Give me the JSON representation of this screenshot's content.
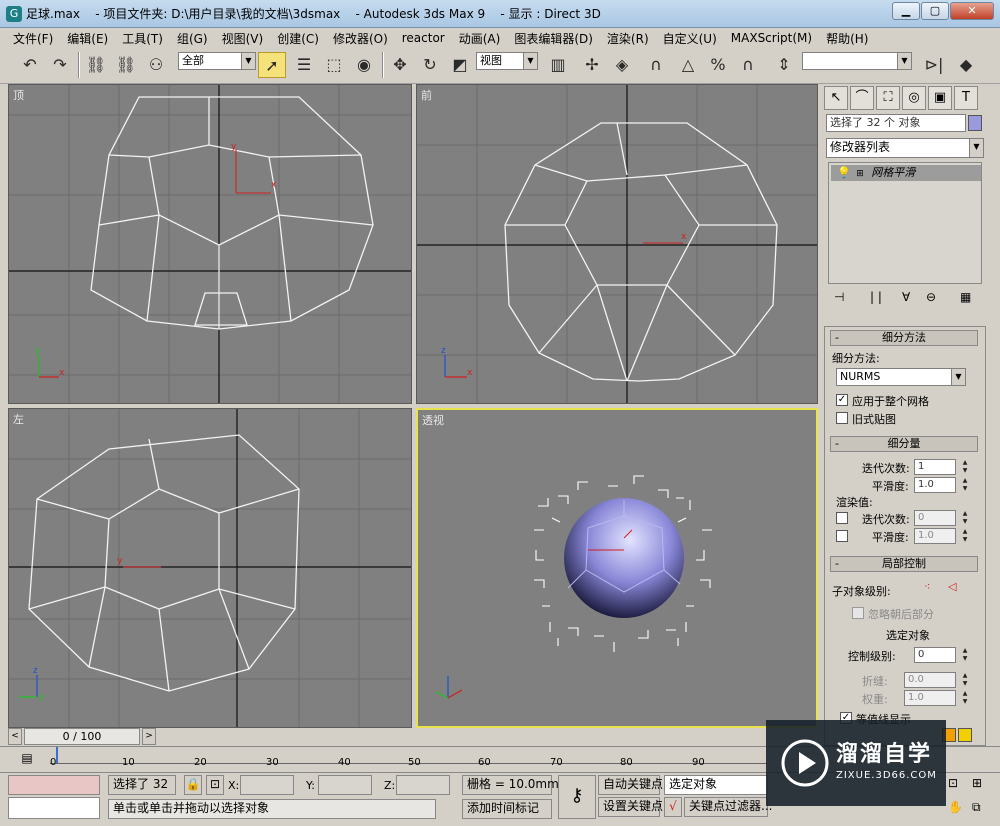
{
  "window": {
    "title": "足球.max    - 项目文件夹: D:\\用户目录\\我的文档\\3dsmax    - Autodesk 3ds Max 9    - 显示 : Direct 3D",
    "app_icon": "3ds-max-icon"
  },
  "menu": [
    "文件(F)",
    "编辑(E)",
    "工具(T)",
    "组(G)",
    "视图(V)",
    "创建(C)",
    "修改器(O)",
    "reactor",
    "动画(A)",
    "图表编辑器(D)",
    "渲染(R)",
    "自定义(U)",
    "MAXScript(M)",
    "帮助(H)"
  ],
  "toolbar": {
    "selection_filter": "全部",
    "ref_coord": "视图"
  },
  "viewports": {
    "top": "顶",
    "front": "前",
    "left": "左",
    "perspective": "透视"
  },
  "command_panel": {
    "selection_text": "选择了 32 个 对象",
    "modifier_list": "修改器列表",
    "stack_item": "网格平滑",
    "rollout_subdiv_method": "细分方法",
    "subdiv_method_label": "细分方法:",
    "subdiv_method_value": "NURMS",
    "apply_whole_mesh": "应用于整个网格",
    "old_style_mapping": "旧式贴图",
    "rollout_subdiv_amount": "细分量",
    "iterations_label": "迭代次数:",
    "iterations_value": "1",
    "smoothness_label": "平滑度:",
    "smoothness_value": "1.0",
    "render_values_label": "渲染值:",
    "render_iterations_label": "迭代次数:",
    "render_iterations_value": "0",
    "render_smoothness_label": "平滑度:",
    "render_smoothness_value": "1.0",
    "rollout_local_control": "局部控制",
    "subobject_level_label": "子对象级别:",
    "ignore_backfacing": "忽略朝后部分",
    "select_object": "选定对象",
    "control_level_label": "控制级别:",
    "control_level_value": "0",
    "crease_label": "折缝:",
    "crease_value": "0.0",
    "weight_label": "权重:",
    "weight_value": "1.0",
    "isoline_display": "等值线显示"
  },
  "timeline": {
    "frame_counter": "0 / 100",
    "ticks": [
      "0",
      "10",
      "20",
      "30",
      "40",
      "50",
      "60",
      "70",
      "80",
      "90"
    ]
  },
  "status": {
    "selected": "选择了 32",
    "x_label": "X:",
    "y_label": "Y:",
    "z_label": "Z:",
    "grid": "栅格 = 10.0mm",
    "auto_key": "自动关键点",
    "set_key": "设置关键点",
    "selected_object": "选定对象",
    "key_filter": "关键点过滤器...",
    "prompt": "单击或单击并拖动以选择对象",
    "add_time_tag": "添加时间标记"
  },
  "watermark": {
    "brand": "溜溜自学",
    "url": "ZIXUE.3D66.COM"
  }
}
